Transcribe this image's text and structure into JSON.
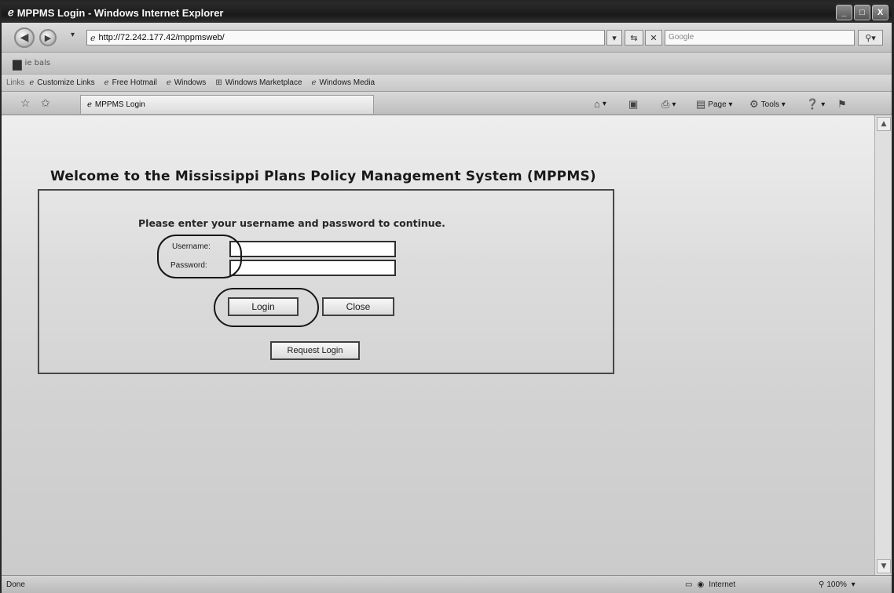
{
  "window": {
    "title": "MPPMS Login - Windows Internet Explorer",
    "minimize": "_",
    "maximize": "□",
    "close": "X"
  },
  "address_bar": {
    "url": "http://72.242.177.42/mppmsweb/",
    "search_placeholder": "Google"
  },
  "google_toolbar": {
    "label": "ie bals"
  },
  "links_bar": {
    "label": "Links",
    "items": [
      "Customize Links",
      "Free Hotmail",
      "Windows",
      "Windows Marketplace",
      "Windows Media"
    ]
  },
  "tab": {
    "title": "MPPMS Login"
  },
  "command_bar": {
    "page": "Page",
    "tools": "Tools"
  },
  "page": {
    "title": "Welcome to the Mississippi Plans Policy Management System (MPPMS)",
    "prompt": "Please enter your username and password to continue.",
    "username_label": "Username:",
    "password_label": "Password:",
    "username_value": "",
    "password_value": "",
    "login_button": "Login",
    "close_button": "Close",
    "request_button": "Request Login"
  },
  "status_bar": {
    "status": "Done",
    "zone": "Internet",
    "zoom": "100%"
  },
  "icons": [
    "ie-icon",
    "back-icon",
    "forward-icon",
    "refresh-icon",
    "stop-icon",
    "search-icon",
    "star-icon",
    "add-favorites-icon",
    "home-icon",
    "print-icon",
    "help-icon",
    "globe-icon"
  ]
}
